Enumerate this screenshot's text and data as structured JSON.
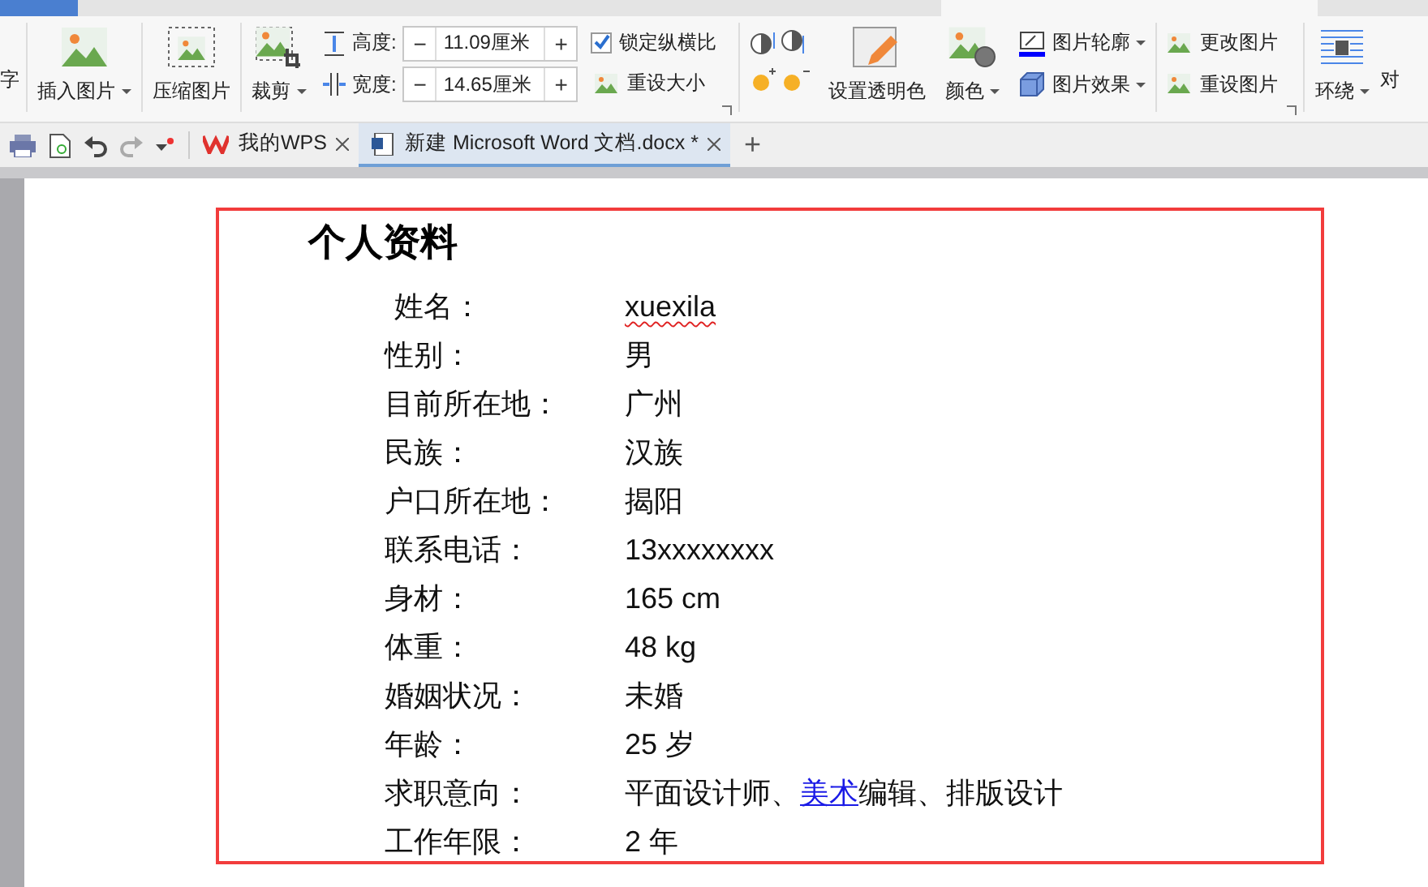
{
  "ribbon": {
    "cut_label": "字",
    "insert_picture": {
      "label": "插入图片",
      "dropdown": true
    },
    "compress_picture": {
      "label": "压缩图片",
      "dropdown": false
    },
    "crop": {
      "label": "裁剪",
      "dropdown": true
    },
    "size_fields": [
      {
        "label": "高度:",
        "value": "11.09厘米",
        "minus": "−",
        "plus": "+"
      },
      {
        "label": "宽度:",
        "value": "14.65厘米",
        "minus": "−",
        "plus": "+"
      }
    ],
    "lock_ratio": {
      "label": "锁定纵横比",
      "checked": true
    },
    "reset_size": {
      "label": "重设大小"
    },
    "transparent": {
      "label": "设置透明色"
    },
    "color": {
      "label": "颜色",
      "dropdown": true
    },
    "outline": {
      "label": "图片轮廓",
      "dropdown": true
    },
    "effects": {
      "label": "图片效果",
      "dropdown": true
    },
    "change_picture": {
      "label": "更改图片"
    },
    "reset_picture": {
      "label": "重设图片"
    },
    "wrap": {
      "label": "环绕",
      "dropdown": true
    },
    "cut_right": "对"
  },
  "doc_tabs": [
    {
      "label": "我的WPS",
      "selected": false,
      "kind": "home"
    },
    {
      "label": "新建 Microsoft Word 文档.docx *",
      "selected": true,
      "kind": "document"
    }
  ],
  "new_tab": "+",
  "document": {
    "title": "个人资料",
    "rows": [
      {
        "label": "姓名：",
        "parts": [
          {
            "text": "xuexila",
            "link": false
          }
        ],
        "spell_error": true
      },
      {
        "label": "性别：",
        "parts": [
          {
            "text": "男",
            "link": false
          }
        ],
        "spell_error": false
      },
      {
        "label": "目前所在地：",
        "parts": [
          {
            "text": "广州",
            "link": false
          }
        ],
        "spell_error": false
      },
      {
        "label": "民族：",
        "parts": [
          {
            "text": "汉族",
            "link": false
          }
        ],
        "spell_error": false
      },
      {
        "label": "户口所在地：",
        "parts": [
          {
            "text": "揭阳",
            "link": false
          }
        ],
        "spell_error": false
      },
      {
        "label": "联系电话：",
        "parts": [
          {
            "text": "13xxxxxxxx",
            "link": false
          }
        ],
        "spell_error": false
      },
      {
        "label": "身材：",
        "parts": [
          {
            "text": "165 cm",
            "link": false
          }
        ],
        "spell_error": false
      },
      {
        "label": "体重：",
        "parts": [
          {
            "text": "48 kg",
            "link": false
          }
        ],
        "spell_error": false
      },
      {
        "label": "婚姻状况：",
        "parts": [
          {
            "text": "未婚",
            "link": false
          }
        ],
        "spell_error": false
      },
      {
        "label": "年龄：",
        "parts": [
          {
            "text": "25  岁",
            "link": false
          }
        ],
        "spell_error": false
      },
      {
        "label": "求职意向：",
        "parts": [
          {
            "text": "平面设计师、",
            "link": false
          },
          {
            "text": "美术",
            "link": true
          },
          {
            "text": "编辑、排版设计",
            "link": false
          }
        ],
        "spell_error": false
      },
      {
        "label": "工作年限：",
        "parts": [
          {
            "text": "2  年",
            "link": false
          }
        ],
        "spell_error": false
      }
    ]
  }
}
